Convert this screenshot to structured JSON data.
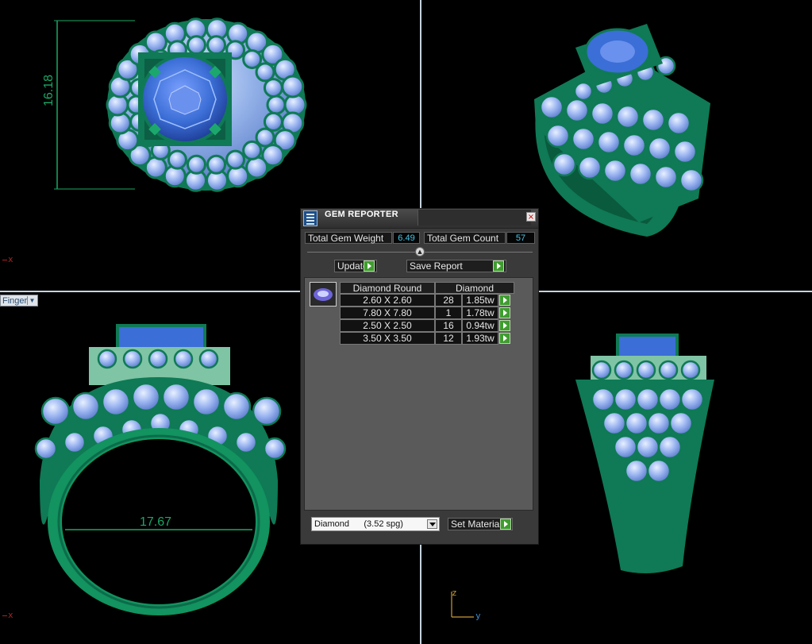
{
  "viewports": {
    "top_left": {
      "dimension": "16.18",
      "axis_label": "x"
    },
    "bottom_left": {
      "dimension": "17.67",
      "axis_label": "x",
      "view_dropdown": "Finger"
    },
    "bottom_right": {
      "axis_z": "z",
      "axis_y": "y"
    }
  },
  "gem_reporter": {
    "title": "GEM REPORTER",
    "close": "×",
    "total_weight_label": "Total Gem Weight",
    "total_weight_value": "6.49",
    "total_count_label": "Total Gem Count",
    "total_count_value": "57",
    "update_label": "Update",
    "save_report_label": "Save Report",
    "table": {
      "shape_header": "Diamond Round",
      "material_header": "Diamond",
      "rows": [
        {
          "size": "2.60 X 2.60",
          "count": "28",
          "weight": "1.85tw"
        },
        {
          "size": "7.80 X 7.80",
          "count": "1",
          "weight": "1.78tw"
        },
        {
          "size": "2.50 X 2.50",
          "count": "16",
          "weight": "0.94tw"
        },
        {
          "size": "3.50 X 3.50",
          "count": "12",
          "weight": "1.93tw"
        }
      ]
    },
    "material_select": "Diamond      (3.52 spg)",
    "set_material_label": "Set Material"
  },
  "colors": {
    "metal": "#0f7a55",
    "gem_pave": "#9fb8f2",
    "center_stone": "#3b6ed6",
    "dimension": "#1aa766",
    "panel_value": "#45c6e6",
    "play_button": "#3f9d2f"
  }
}
